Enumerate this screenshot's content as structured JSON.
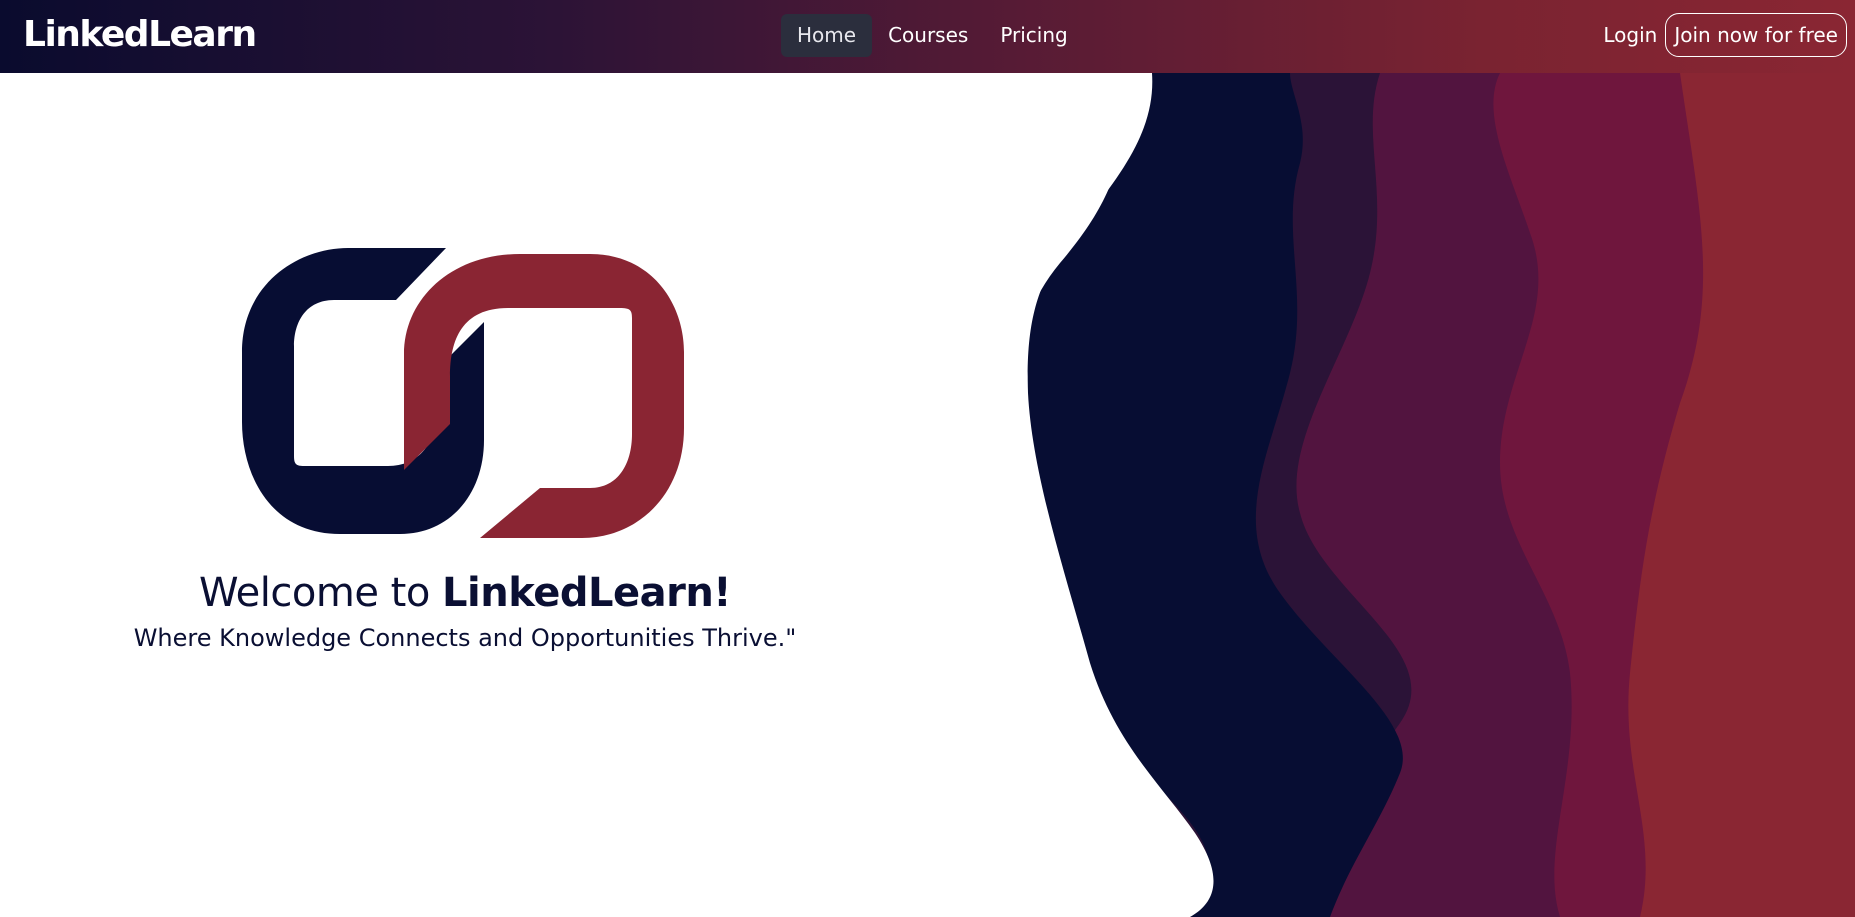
{
  "navbar": {
    "brand": "LinkedLearn",
    "links": [
      {
        "label": "Home",
        "active": true
      },
      {
        "label": "Courses",
        "active": false
      },
      {
        "label": "Pricing",
        "active": false
      }
    ],
    "login_label": "Login",
    "join_label": "Join now for free"
  },
  "hero": {
    "title_prefix": "Welcome to ",
    "title_brand": "LinkedLearn!",
    "subtitle": "Where Knowledge Connects and Opportunities Thrive.\""
  },
  "colors": {
    "navy": "#070d33",
    "crimson": "#8a2533",
    "wave_1": "#070d33",
    "wave_2": "#2b1337",
    "wave_3": "#52143f",
    "wave_4": "#6f163d",
    "wave_5": "#8a2633"
  },
  "icons": {
    "logo": "linked-chain-logo"
  }
}
